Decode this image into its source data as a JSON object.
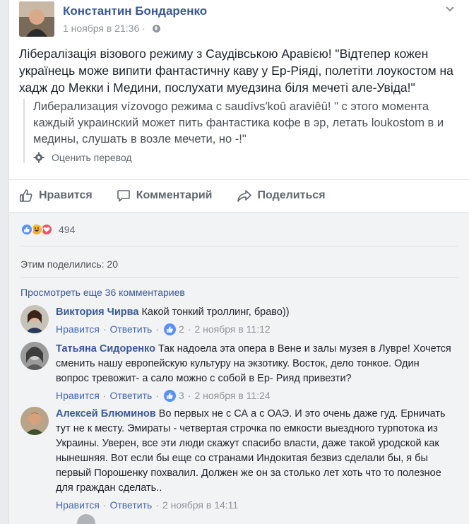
{
  "post": {
    "author": "Константин Бондаренко",
    "timestamp": "1 ноября в 21:36",
    "dot": "·",
    "text": "Лібералізація візового режиму з Саудівською Аравією! \"Відтепер кожен українець може випити фантастичну каву у Ер-Ріяді, полетіти лоукостом на хадж до Мекки і Медини, послухати муедзина біля мечеті але-Увіда!\"",
    "translation": "Либерализация vízovogo режима с saudívs'koû araviêû! \" с этого момента каждый украинский может пить фантастика кофе в эр, летать loukostom в и медины, слушать в возле мечети, но -!\"",
    "rate_translation": "Оценить перевод"
  },
  "actions": {
    "like": "Нравится",
    "comment": "Комментарий",
    "share": "Поделиться"
  },
  "reactions": {
    "count": "494"
  },
  "shares_text": "Этим поделились: 20",
  "view_more": "Просмотреть еще 36 комментариев",
  "comments": [
    {
      "name": "Виктория Чирва",
      "text": "Какой тонкий троллинг, браво))",
      "like": "Нравится",
      "reply": "Ответить",
      "likes": "2",
      "time": "2 ноября в 11:12"
    },
    {
      "name": "Татьяна Сидоренко",
      "text": "Так надоела эта опера в Вене и залы музея в Лувре! Хочется сменить нашу европейскую культуру на экзотику. Восток, дело тонкое. Один вопрос тревожит- а сало можно с собой в Ер- Рияд привезти?",
      "like": "Нравится",
      "reply": "Ответить",
      "likes": "3",
      "time": "2 ноября в 11:24"
    },
    {
      "name": "Алексей Блюминов",
      "text": "Во первых не с СА а с ОАЭ. И это очень даже гуд. Ерничать тут не к месту. Эмираты - четвертая строчка по емкости выездного турпотока из Украины. Уверен, все эти люди скажут спасибо власти, даже такой уродской как нынешняя. Вот если бы еще со странами Индокитая безвиз сделали бы, я бы первый Порошенку похвалил. Должен же он за столько лет хоть что то полезное для граждан сделать..",
      "like": "Нравится",
      "reply": "Ответить",
      "time": "2 ноября в 14:11"
    }
  ],
  "colors": {
    "link": "#385898",
    "muted": "#90949c",
    "like_blue": "#5890ff",
    "haha": "#f7b125",
    "love": "#f25268"
  }
}
